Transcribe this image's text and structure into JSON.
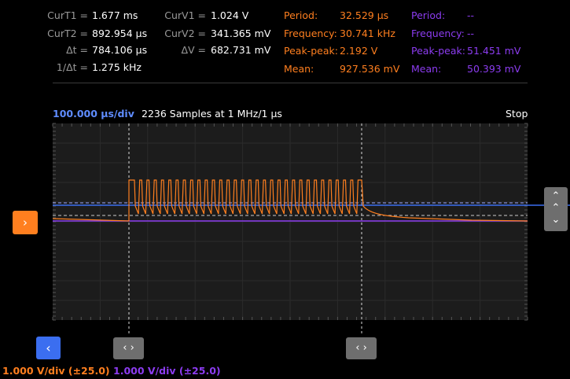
{
  "measurements": {
    "curt1": {
      "label": "CurT1 =",
      "value": "1.677 ms"
    },
    "curt2": {
      "label": "CurT2 =",
      "value": "892.954 µs"
    },
    "dt": {
      "label": "Δt =",
      "value": "784.106 µs"
    },
    "inv_dt": {
      "label": "1/Δt =",
      "value": "1.275 kHz"
    },
    "curv1": {
      "label": "CurV1 =",
      "value": "1.024 V"
    },
    "curv2": {
      "label": "CurV2 =",
      "value": "341.365 mV"
    },
    "dv": {
      "label": "ΔV =",
      "value": "682.731 mV"
    }
  },
  "channel1_stats": {
    "period": {
      "label": "Period:",
      "value": "32.529 µs"
    },
    "frequency": {
      "label": "Frequency:",
      "value": "30.741 kHz"
    },
    "peak_peak": {
      "label": "Peak-peak:",
      "value": "2.192 V"
    },
    "mean": {
      "label": "Mean:",
      "value": "927.536 mV"
    }
  },
  "channel2_stats": {
    "period": {
      "label": "Period:",
      "value": "--"
    },
    "frequency": {
      "label": "Frequency:",
      "value": "--"
    },
    "peak_peak": {
      "label": "Peak-peak:",
      "value": "51.451 mV"
    },
    "mean": {
      "label": "Mean:",
      "value": "50.393 mV"
    }
  },
  "timebase": "100.000 µs/div",
  "samples": "2236 Samples at 1 MHz/1 µs",
  "run_state": "Stop",
  "channel1_scale": "1.000 V/div (±25.0)",
  "channel2_scale": "1.000 V/div (±25.0)",
  "icons": {
    "trigger": "›",
    "back": "‹",
    "cursor": "‹ ›",
    "up": "⌃",
    "down": "⌄"
  },
  "colors": {
    "channel1": "#ff7f1f",
    "channel2": "#8c3cf0",
    "timebase": "#5f8cff",
    "grid_bg": "#1c1c1c"
  }
}
